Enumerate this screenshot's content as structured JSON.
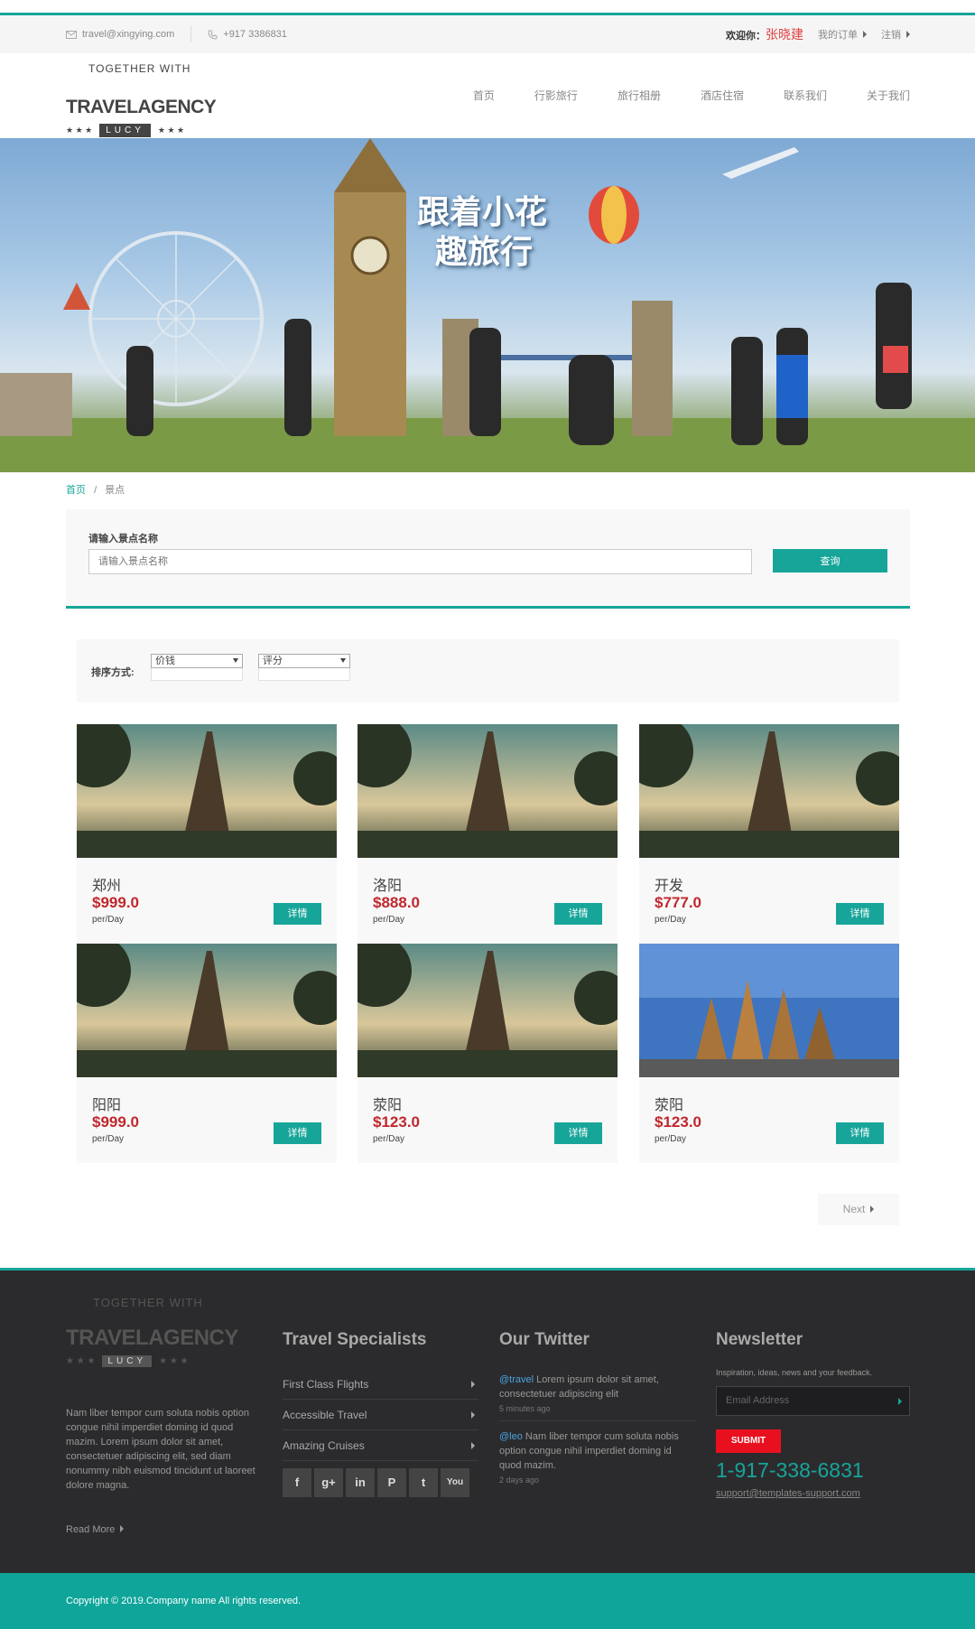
{
  "topbar": {
    "email": "travel@xingying.com",
    "phone": "+917 3386831",
    "welcome": "欢迎你：",
    "username": "张晓建",
    "orders": "我的订单",
    "logout": "注销"
  },
  "logo": {
    "arc": "TOGETHER WITH",
    "name": "TRAVELAGENCY",
    "badge": "LUCY"
  },
  "nav": [
    "首页",
    "行影旅行",
    "旅行相册",
    "酒店住宿",
    "联系我们",
    "关于我们"
  ],
  "hero": {
    "title_line1": "跟着小花",
    "title_line2": "趣旅行"
  },
  "breadcrumb": {
    "home": "首页",
    "sep": "/",
    "current": "景点"
  },
  "search": {
    "label": "请输入景点名称",
    "placeholder": "请输入景点名称",
    "button": "查询"
  },
  "sort": {
    "label": "排序方式:",
    "select1": "价钱",
    "select2": "评分"
  },
  "cards": [
    {
      "city": "郑州",
      "price": "$999.0",
      "per": "per/Day",
      "btn": "详情"
    },
    {
      "city": "洛阳",
      "price": "$888.0",
      "per": "per/Day",
      "btn": "详情"
    },
    {
      "city": "开发",
      "price": "$777.0",
      "per": "per/Day",
      "btn": "详情"
    },
    {
      "city": "阳阳",
      "price": "$999.0",
      "per": "per/Day",
      "btn": "详情"
    },
    {
      "city": "荥阳",
      "price": "$123.0",
      "per": "per/Day",
      "btn": "详情"
    },
    {
      "city": "荥阳",
      "price": "$123.0",
      "per": "per/Day",
      "btn": "详情"
    }
  ],
  "pagination": {
    "next": "Next"
  },
  "footer": {
    "about": "Nam liber tempor cum soluta nobis option congue nihil imperdiet doming id quod mazim. Lorem ipsum dolor sit amet, consectetuer adipiscing elit, sed diam nonummy nibh euismod tincidunt ut laoreet dolore magna.",
    "read_more": "Read More",
    "specialists_title": "Travel Specialists",
    "links": [
      "First Class Flights",
      "Accessible Travel",
      "Amazing Cruises"
    ],
    "socials": [
      "f",
      "g+",
      "in",
      "P",
      "t",
      "You"
    ],
    "twitter_title": "Our Twitter",
    "tweets": [
      {
        "handle": "@travel",
        "text": " Lorem ipsum dolor sit amet, consectetuer adipiscing elit",
        "time": "5 minutes ago"
      },
      {
        "handle": "@leo",
        "text": " Nam liber tempor cum soluta nobis option congue nihil imperdiet doming id quod mazim.",
        "time": "2 days ago"
      }
    ],
    "newsletter_title": "Newsletter",
    "newsletter_text": "Inspiration, ideas, news and your feedback.",
    "email_placeholder": "Email Address",
    "submit": "SUBMIT",
    "phone": "1-917-338-6831",
    "support_email": "support@templates-support.com"
  },
  "copyright": "Copyright © 2019.Company name All rights reserved."
}
